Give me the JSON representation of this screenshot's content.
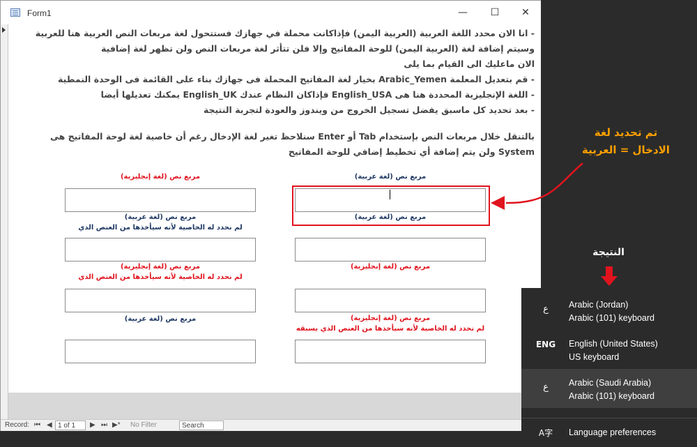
{
  "window": {
    "title": "Form1",
    "minimize_glyph": "—",
    "maximize_glyph": "☐",
    "close_glyph": "✕"
  },
  "instructions": {
    "line1": "- انا الان محدد اللغة العربية (العربية اليمن) فإذاكانت محملة في جهازك فستتحول لغة مربعات النص العربية هنا للعربية",
    "line2": "وسيتم إضافة لغة (العربية اليمن) للوحة المفاتيح وإلا فلن تتأثر لغة مربعات النص ولن تظهر لغة إضافية",
    "line3": "الان ماعليك الى القيام بما يلى",
    "line4": "- قم بتعديل المعلمة Arabic_Yemen بخيار لغة المفاتيح المحملة فى جهازك بناء على القائمة فى الوحدة النمطية",
    "line5": "- اللغة الإنجليزية المحددة هنا هى English_USA فإذاكان النظام عندك English_UK يمكنك تعديلها أيضا",
    "line6": "- بعد تحديد كل ماسبق يفضل تسجيل الخروج من ويندوز والعودة لتجربة النتيجة",
    "line7": "بالتنقل خلال مربعات النص بإستخدام Tab أو Enter سنلاحظ تغير لغة الإدخال رغم أن خاصية لغة لوحة المفاتيح هى",
    "line8": "System ولن يتم إضافة أي تخطيط إضافي للوحة المفاتيح"
  },
  "labels": {
    "arabic_box": "مربع نص (لغة عربية)",
    "english_box": "مربع نص (لغة إنجليزية)",
    "not_set_above": "لم نحدد له الخاصية لأنه سيأخذها من العنص الذي",
    "not_set_previous": "لم نحدد له الخاصية لأنه سيأخذها من العنص الذي يسبقه"
  },
  "annotation": {
    "line1": "تم تحديد لغة",
    "line2": "الادخال = العربية",
    "result": "النتيجة"
  },
  "statusbar": {
    "record_label": "Record:",
    "first": "⏮",
    "prev": "◀",
    "position": "1 of 1",
    "next": "▶",
    "last": "⏭",
    "new": "▶*",
    "filter": "No Filter",
    "search_placeholder": "Search"
  },
  "language_flyout": {
    "items": [
      {
        "abbr": "ع",
        "name": "Arabic (Jordan)",
        "keyboard": "Arabic (101) keyboard",
        "selected": false
      },
      {
        "abbr": "ENG",
        "name": "English (United States)",
        "keyboard": "US keyboard",
        "selected": false
      },
      {
        "abbr": "ع",
        "name": "Arabic (Saudi Arabia)",
        "keyboard": "Arabic (101) keyboard",
        "selected": true
      }
    ],
    "preferences_label": "Language preferences",
    "preferences_icon": "A字"
  },
  "colors": {
    "accent_red": "#e0141e",
    "annotation_orange": "#ffa000",
    "label_blue": "#1f3864",
    "flyout_bg": "#2b2b2b"
  }
}
